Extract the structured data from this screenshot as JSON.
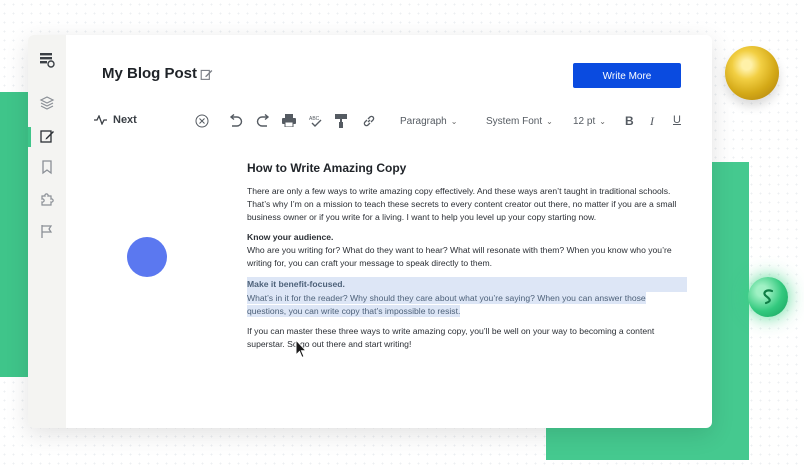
{
  "app": {
    "title": "My Blog Post",
    "write_more_label": "Write More"
  },
  "sidebar": {
    "items": [
      {
        "icon": "logo-icon"
      },
      {
        "icon": "layers-icon"
      },
      {
        "icon": "edit-icon",
        "active": true
      },
      {
        "icon": "bookmark-icon"
      },
      {
        "icon": "puzzle-icon"
      },
      {
        "icon": "flag-icon"
      }
    ]
  },
  "toolbar": {
    "next_label": "Next",
    "paragraph_label": "Paragraph",
    "font_label": "System Font",
    "size_label": "12 pt",
    "bold_label": "B",
    "italic_label": "I",
    "underline_label": "U"
  },
  "document": {
    "heading": "How to Write Amazing Copy",
    "intro": "There are only a few ways to write amazing copy effectively. And these ways aren’t taught in traditional schools. That’s why I’m on a mission to teach these secrets to every content creator out there, no matter if you are a small business owner or if you write for a living. I want to help you level up your copy starting now.",
    "section1_title": "Know your audience.",
    "section1_body": "Who are you writing for? What do they want to hear? What will resonate with them? When you know who you’re writing for, you can craft your message to speak directly to them.",
    "section2_title": "Make it benefit-focused.",
    "section2_body": "What’s in it for the reader? Why should they care about what you’re saying? When you can answer those questions, you can write copy that’s impossible to resist.",
    "outro": "If you can master these three ways to write amazing copy, you’ll be well on your way to becoming a content superstar. So go out there and start writing!"
  },
  "colors": {
    "accent": "#0a4be0",
    "green": "#3fc58a",
    "highlight": "#dde6f6"
  }
}
